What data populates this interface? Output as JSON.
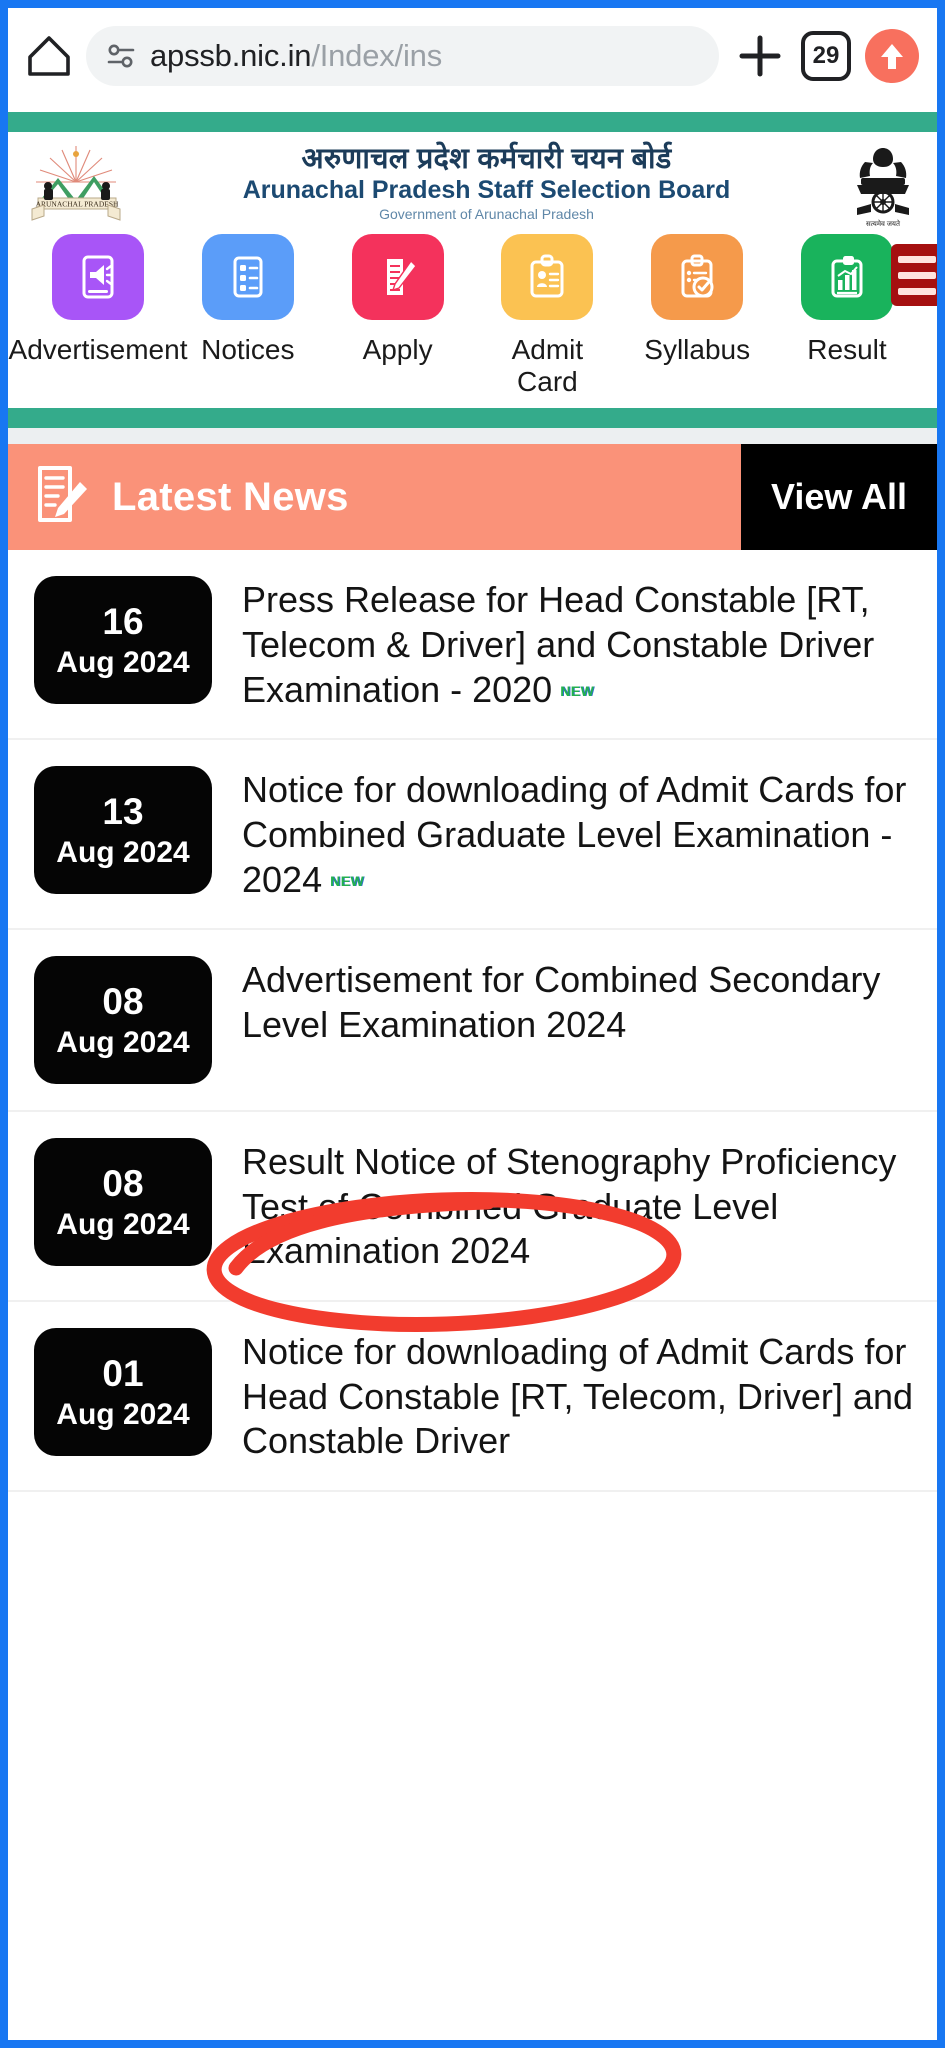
{
  "browser": {
    "home_icon": "home-icon",
    "permission_icon": "site-permissions-icon",
    "url_visible": "apssb.nic.in/Index/ins",
    "url_domain": "apssb.nic.in",
    "url_path": "/Index/ins",
    "new_tab_icon": "plus-icon",
    "tab_count": "29",
    "profile_icon": "upload-arrow-icon"
  },
  "site": {
    "title_hi": "अरुणाचल प्रदेश कर्मचारी चयन बोर्ड",
    "title_en": "Arunachal Pradesh Staff Selection Board",
    "subtitle": "Government of Arunachal Pradesh",
    "left_emblem_caption": "ARUNACHAL PRADESH",
    "right_emblem_caption": "सत्यमेव जयते",
    "menu_icon": "hamburger-menu-icon",
    "accent_teal": "#34ab8b"
  },
  "quicknav": [
    {
      "label": "Advertisement",
      "icon": "megaphone-announcement-icon",
      "color": "#a855f7"
    },
    {
      "label": "Notices",
      "icon": "document-list-icon",
      "color": "#5b9df9"
    },
    {
      "label": "Apply",
      "icon": "form-pencil-icon",
      "color": "#f4325c"
    },
    {
      "label": "Admit Card",
      "icon": "id-card-icon",
      "color": "#fbc košer"
    },
    {
      "label": "Syllabus",
      "icon": "clipboard-check-icon",
      "color": "#f59a4b"
    },
    {
      "label": "Result",
      "icon": "chart-result-icon",
      "color": "#19b35c"
    }
  ],
  "news_section": {
    "title": "Latest News",
    "title_icon": "news-edit-icon",
    "view_all_label": "View All",
    "header_bg": "#fa9279"
  },
  "news_items": [
    {
      "day": "16",
      "month_year": "Aug 2024",
      "text": "Press Release for Head Constable [RT, Telecom & Driver] and Constable Driver Examination - 2020",
      "new_badge": "NEW"
    },
    {
      "day": "13",
      "month_year": "Aug 2024",
      "text": "Notice for downloading of Admit Cards for Combined Graduate Level Examination - 2024",
      "new_badge": "NEW"
    },
    {
      "day": "08",
      "month_year": "Aug 2024",
      "text": "Advertisement for Combined Secondary Level Examination 2024",
      "new_badge": ""
    },
    {
      "day": "08",
      "month_year": "Aug 2024",
      "text": "Result Notice of Stenography Proficiency Test of Combined Graduate Level Examination 2024",
      "new_badge": ""
    },
    {
      "day": "01",
      "month_year": "Aug 2024",
      "text": "Notice for downloading of Admit Cards for Head Constable [RT, Telecom, Driver] and Constable Driver",
      "new_badge": ""
    }
  ],
  "annotation": {
    "type": "red-ellipse-highlight",
    "color": "#f23c2e",
    "targets_item_index": 2
  }
}
